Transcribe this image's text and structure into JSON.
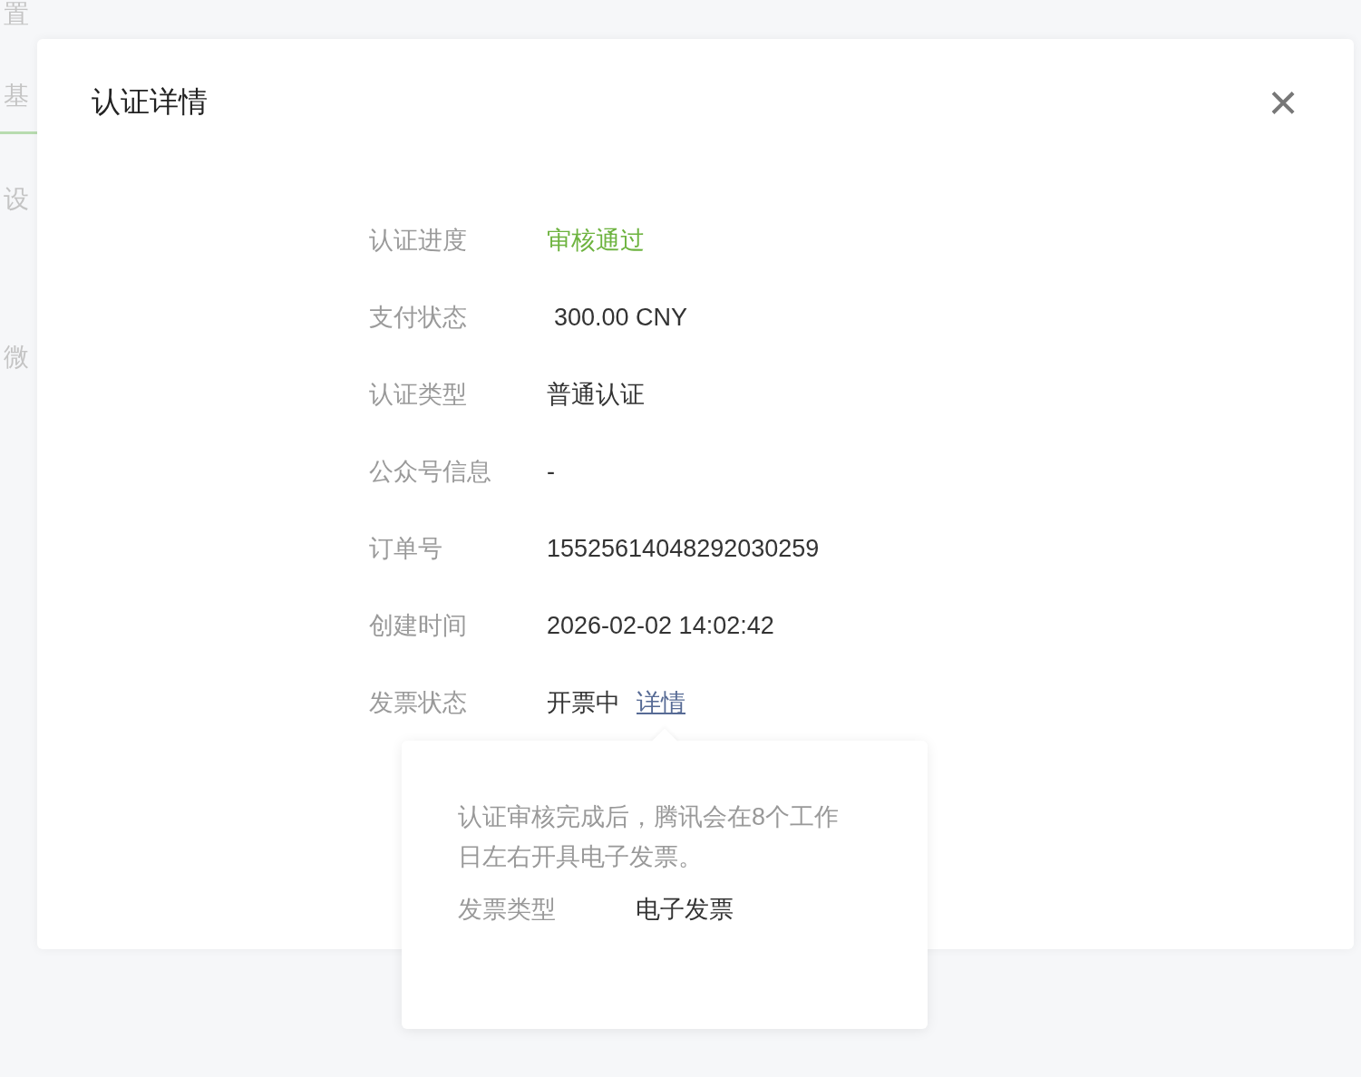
{
  "background": {
    "items": [
      "置",
      "基",
      "设",
      "微"
    ]
  },
  "dialog": {
    "title": "认证详情",
    "close": "×",
    "fields": [
      {
        "label": "认证进度",
        "value": "审核通过",
        "kind": "status"
      },
      {
        "label": "支付状态",
        "value": "300.00 CNY",
        "kind": "amount"
      },
      {
        "label": "认证类型",
        "value": "普通认证",
        "kind": "plain"
      },
      {
        "label": "公众号信息",
        "value": "-",
        "kind": "plain"
      },
      {
        "label": "订单号",
        "value": "15525614048292030259",
        "kind": "plain"
      },
      {
        "label": "创建时间",
        "value": "2026-02-02 14:02:42",
        "kind": "plain"
      },
      {
        "label": "发票状态",
        "value": "开票中",
        "link": "详情",
        "kind": "link"
      }
    ]
  },
  "popover": {
    "message": "认证审核完成后，腾讯会在8个工作日左右开具电子发票。",
    "fields": [
      {
        "label": "发票类型",
        "value": "电子发票"
      }
    ]
  }
}
